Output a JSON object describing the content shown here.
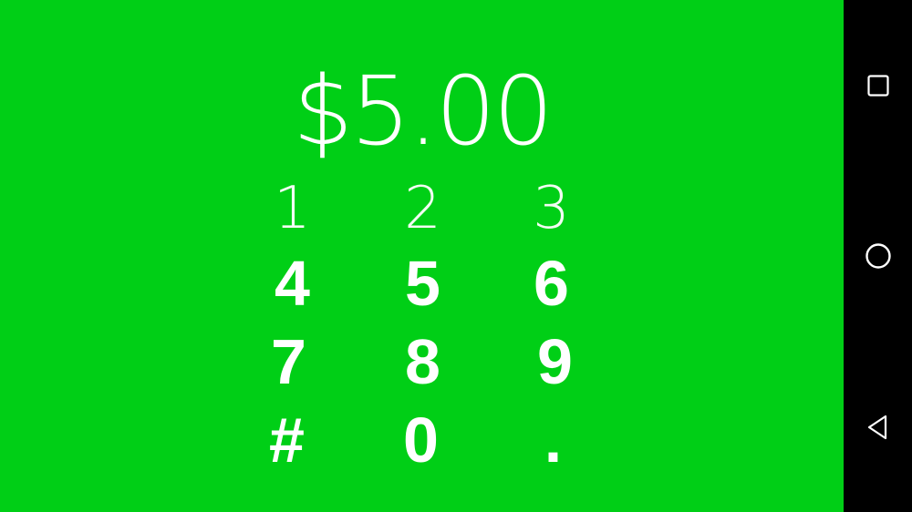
{
  "payment": {
    "amount": "$5.00"
  },
  "keypad": {
    "keys": [
      "1",
      "2",
      "3",
      "4",
      "5",
      "6",
      "7",
      "8",
      "9",
      "#",
      "0",
      "."
    ]
  },
  "navbar": {
    "icons": [
      "recent-apps-icon",
      "home-icon",
      "back-icon"
    ]
  },
  "colors": {
    "screen_background": "#00CF16",
    "text": "#FFFFFF",
    "navbar_background": "#000000"
  }
}
